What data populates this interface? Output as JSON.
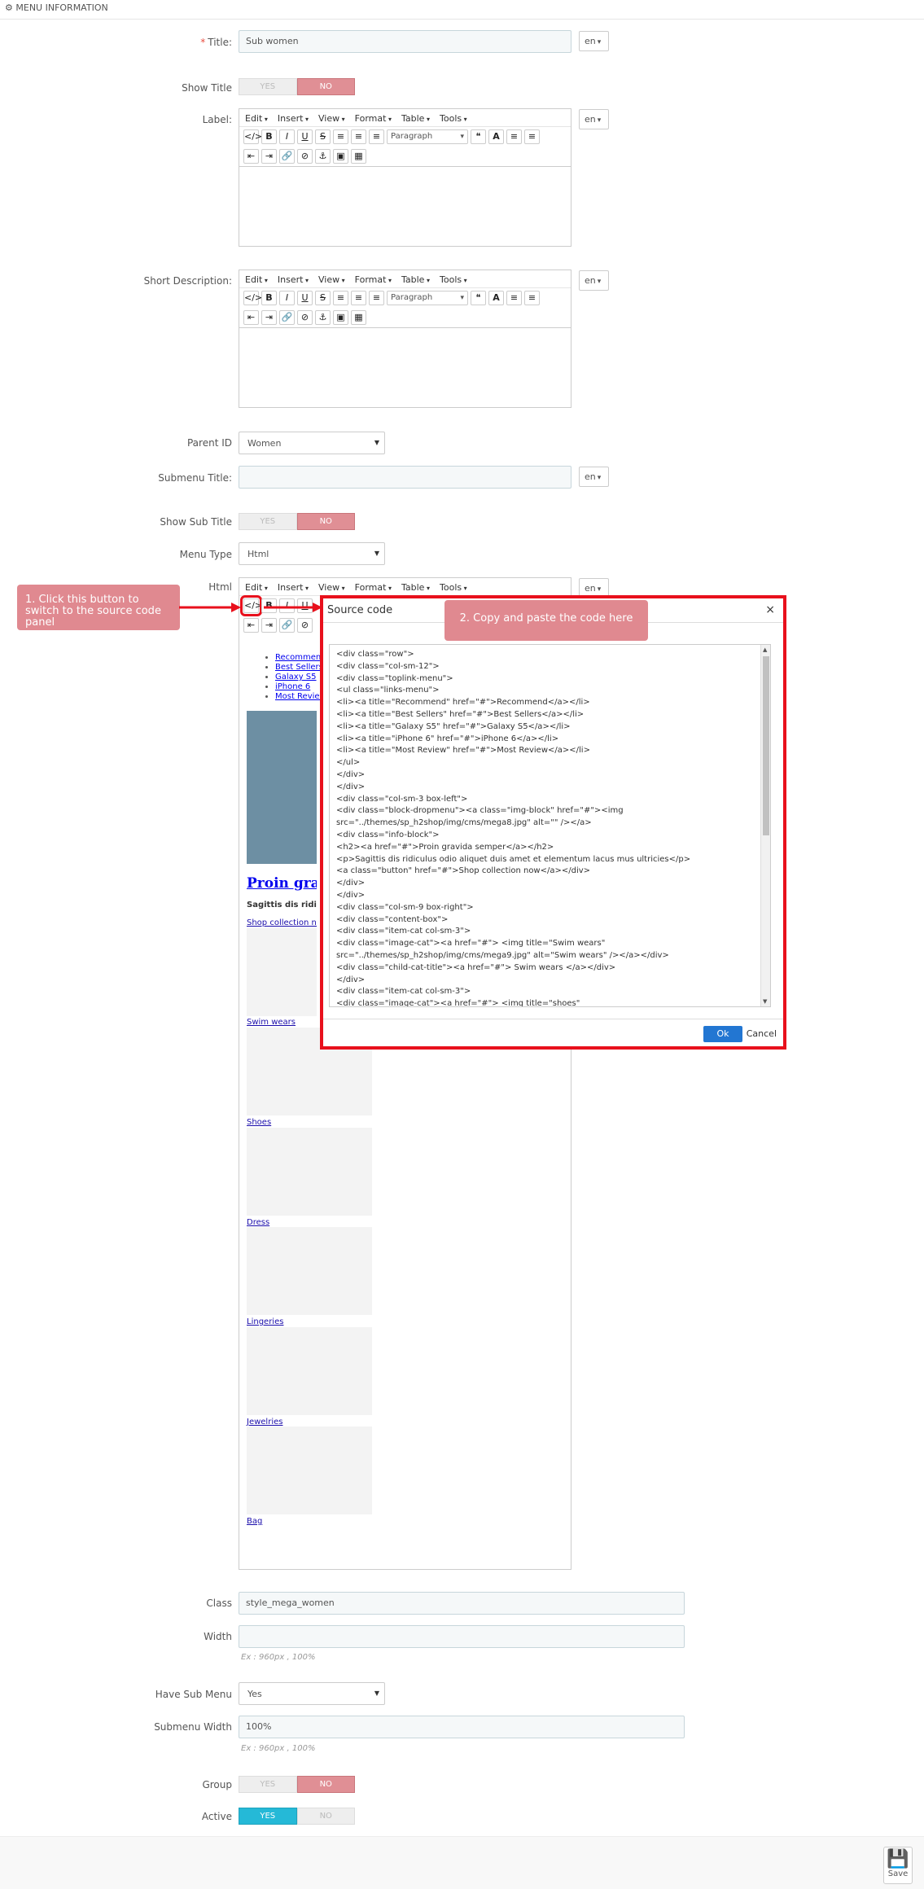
{
  "header": {
    "title": "MENU INFORMATION"
  },
  "form": {
    "title_label": "Title:",
    "title_value": "Sub women",
    "lang": "en",
    "show_title_label": "Show Title",
    "yes": "YES",
    "no": "NO",
    "label_label": "Label:",
    "short_desc_label": "Short Description:",
    "parent_id_label": "Parent ID",
    "parent_id_value": "Women",
    "submenu_title_label": "Submenu Title:",
    "show_sub_title_label": "Show Sub Title",
    "menu_type_label": "Menu Type",
    "menu_type_value": "Html",
    "html_label": "Html",
    "class_label": "Class",
    "class_value": "style_mega_women",
    "width_label": "Width",
    "width_hint": "Ex : 960px , 100%",
    "have_sub_label": "Have Sub Menu",
    "have_sub_value": "Yes",
    "submenu_width_label": "Submenu Width",
    "submenu_width_value": "100%",
    "submenu_width_hint": "Ex : 960px , 100%",
    "group_label": "Group",
    "active_label": "Active"
  },
  "editor": {
    "menu": [
      "Edit",
      "Insert",
      "View",
      "Format",
      "Table",
      "Tools"
    ],
    "paragraph": "Paragraph"
  },
  "callouts": {
    "step1": "1. Click this button to switch to the source code panel",
    "step2": "2. Copy and paste the code here"
  },
  "modal": {
    "title": "Source code",
    "close": "×",
    "ok": "Ok",
    "cancel": "Cancel",
    "code": "<div class=\"row\">\n<div class=\"col-sm-12\">\n<div class=\"toplink-menu\">\n<ul class=\"links-menu\">\n<li><a title=\"Recommend\" href=\"#\">Recommend</a></li>\n<li><a title=\"Best Sellers\" href=\"#\">Best Sellers</a></li>\n<li><a title=\"Galaxy S5\" href=\"#\">Galaxy S5</a></li>\n<li><a title=\"iPhone 6\" href=\"#\">iPhone 6</a></li>\n<li><a title=\"Most Review\" href=\"#\">Most Review</a></li>\n</ul>\n</div>\n</div>\n<div class=\"col-sm-3 box-left\">\n<div class=\"block-dropmenu\"><a class=\"img-block\" href=\"#\"><img\nsrc=\"../themes/sp_h2shop/img/cms/mega8.jpg\" alt=\"\" /></a>\n<div class=\"info-block\">\n<h2><a href=\"#\">Proin gravida semper</a></h2>\n<p>Sagittis dis ridiculus odio aliquet duis amet et elementum lacus mus ultricies</p>\n<a class=\"button\" href=\"#\">Shop collection now</a></div>\n</div>\n</div>\n<div class=\"col-sm-9 box-right\">\n<div class=\"content-box\">\n<div class=\"item-cat col-sm-3\">\n<div class=\"image-cat\"><a href=\"#\"> <img title=\"Swim wears\"\nsrc=\"../themes/sp_h2shop/img/cms/mega9.jpg\" alt=\"Swim wears\" /></a></div>\n<div class=\"child-cat-title\"><a href=\"#\"> Swim wears </a></div>\n</div>\n<div class=\"item-cat col-sm-3\">\n<div class=\"image-cat\"><a href=\"#\"> <img title=\"shoes\""
  },
  "preview": {
    "links": [
      "Recommend",
      "Best Sellers",
      "Galaxy S5",
      "iPhone 6",
      "Most Review"
    ],
    "heading": "Proin gravida semper",
    "text": "Sagittis dis ridiculus odio aliquet duis amet et elementum lacus mus ultricies",
    "shop": "Shop collection now",
    "cats": [
      "Swim wears",
      "Shoes",
      "Dress",
      "Lingeries",
      "Jewelries",
      "Bag"
    ]
  },
  "footer": {
    "save": "Save"
  }
}
